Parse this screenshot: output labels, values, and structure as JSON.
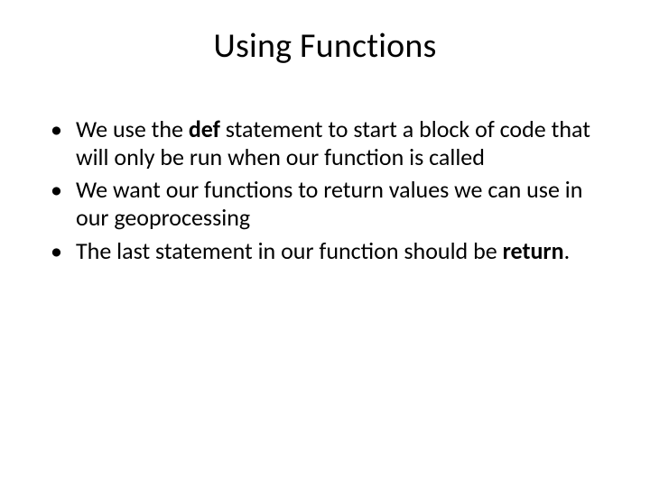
{
  "title": "Using Functions",
  "bullets": [
    {
      "pre": "We use the ",
      "bold": "def",
      "post": " statement to start a block of code that will only be run when our function is called"
    },
    {
      "pre": "We want our functions to return values we can use in our geoprocessing",
      "bold": "",
      "post": ""
    },
    {
      "pre": "The last statement in our function should be ",
      "bold": "return",
      "post": "."
    }
  ]
}
